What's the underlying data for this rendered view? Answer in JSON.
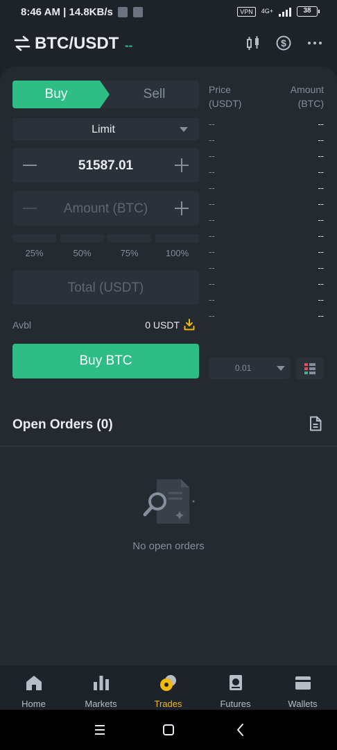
{
  "status_bar": {
    "time": "8:46 AM | 14.8KB/s",
    "vpn": "VPN",
    "network": "4G+",
    "battery": "38"
  },
  "header": {
    "pair": "BTC/USDT",
    "change": "--"
  },
  "trade_form": {
    "tabs": {
      "buy": "Buy",
      "sell": "Sell"
    },
    "order_type": "Limit",
    "price_value": "51587.01",
    "amount_placeholder": "Amount (BTC)",
    "percentages": [
      "25%",
      "50%",
      "75%",
      "100%"
    ],
    "total_placeholder": "Total (USDT)",
    "avbl_label": "Avbl",
    "avbl_value": "0 USDT",
    "submit_label": "Buy BTC"
  },
  "order_book": {
    "price_header_line1": "Price",
    "price_header_line2": "(USDT)",
    "amount_header_line1": "Amount",
    "amount_header_line2": "(BTC)",
    "rows": [
      {
        "price": "--",
        "amount": "--"
      },
      {
        "price": "--",
        "amount": "--"
      },
      {
        "price": "--",
        "amount": "--"
      },
      {
        "price": "--",
        "amount": "--"
      },
      {
        "price": "--",
        "amount": "--"
      },
      {
        "price": "--",
        "amount": "--"
      },
      {
        "price": "--",
        "amount": "--"
      },
      {
        "price": "--",
        "amount": "--"
      },
      {
        "price": "--",
        "amount": "--"
      },
      {
        "price": "--",
        "amount": "--"
      },
      {
        "price": "--",
        "amount": "--"
      },
      {
        "price": "--",
        "amount": "--"
      },
      {
        "price": "--",
        "amount": "--"
      }
    ],
    "depth_value": "0.01"
  },
  "open_orders": {
    "title": "Open Orders (0)",
    "empty_text": "No open orders"
  },
  "bottom_nav": {
    "items": [
      {
        "label": "Home",
        "icon": "home-icon"
      },
      {
        "label": "Markets",
        "icon": "markets-icon"
      },
      {
        "label": "Trades",
        "icon": "trades-icon"
      },
      {
        "label": "Futures",
        "icon": "futures-icon"
      },
      {
        "label": "Wallets",
        "icon": "wallets-icon"
      }
    ],
    "active": "Trades"
  },
  "colors": {
    "buy_green": "#2ebd85",
    "accent_yellow": "#f0b90b",
    "background": "#1e2329",
    "panel": "#252930"
  }
}
